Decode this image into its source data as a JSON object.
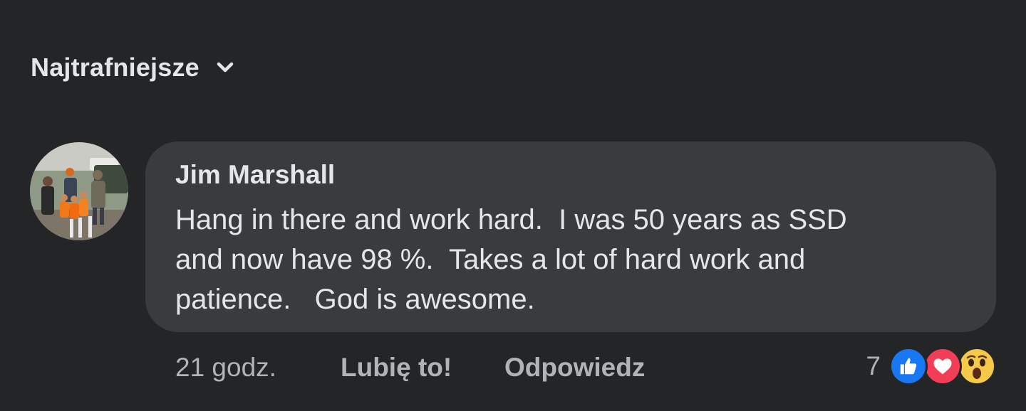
{
  "sort": {
    "label": "Najtrafniejsze",
    "chevron_icon": "chevron-down-icon"
  },
  "comment": {
    "author": "Jim Marshall",
    "text": "Hang in there and work hard.  I was 50 years as SSD\nand now have 98 %.  Takes a lot of hard work and\npatience.   God is awesome.",
    "time": "21 godz.",
    "like_label": "Lubię to!",
    "reply_label": "Odpowiedz",
    "reaction_count": "7",
    "reactions": [
      "like-icon",
      "love-icon",
      "wow-icon"
    ]
  },
  "colors": {
    "background": "#242526",
    "bubble": "#3a3b3c",
    "text_primary": "#e4e6eb",
    "text_secondary": "#b0b3b8",
    "like_blue": "#1877f2",
    "love_red": "#f33e58",
    "wow_yellow": "#f7c948"
  }
}
